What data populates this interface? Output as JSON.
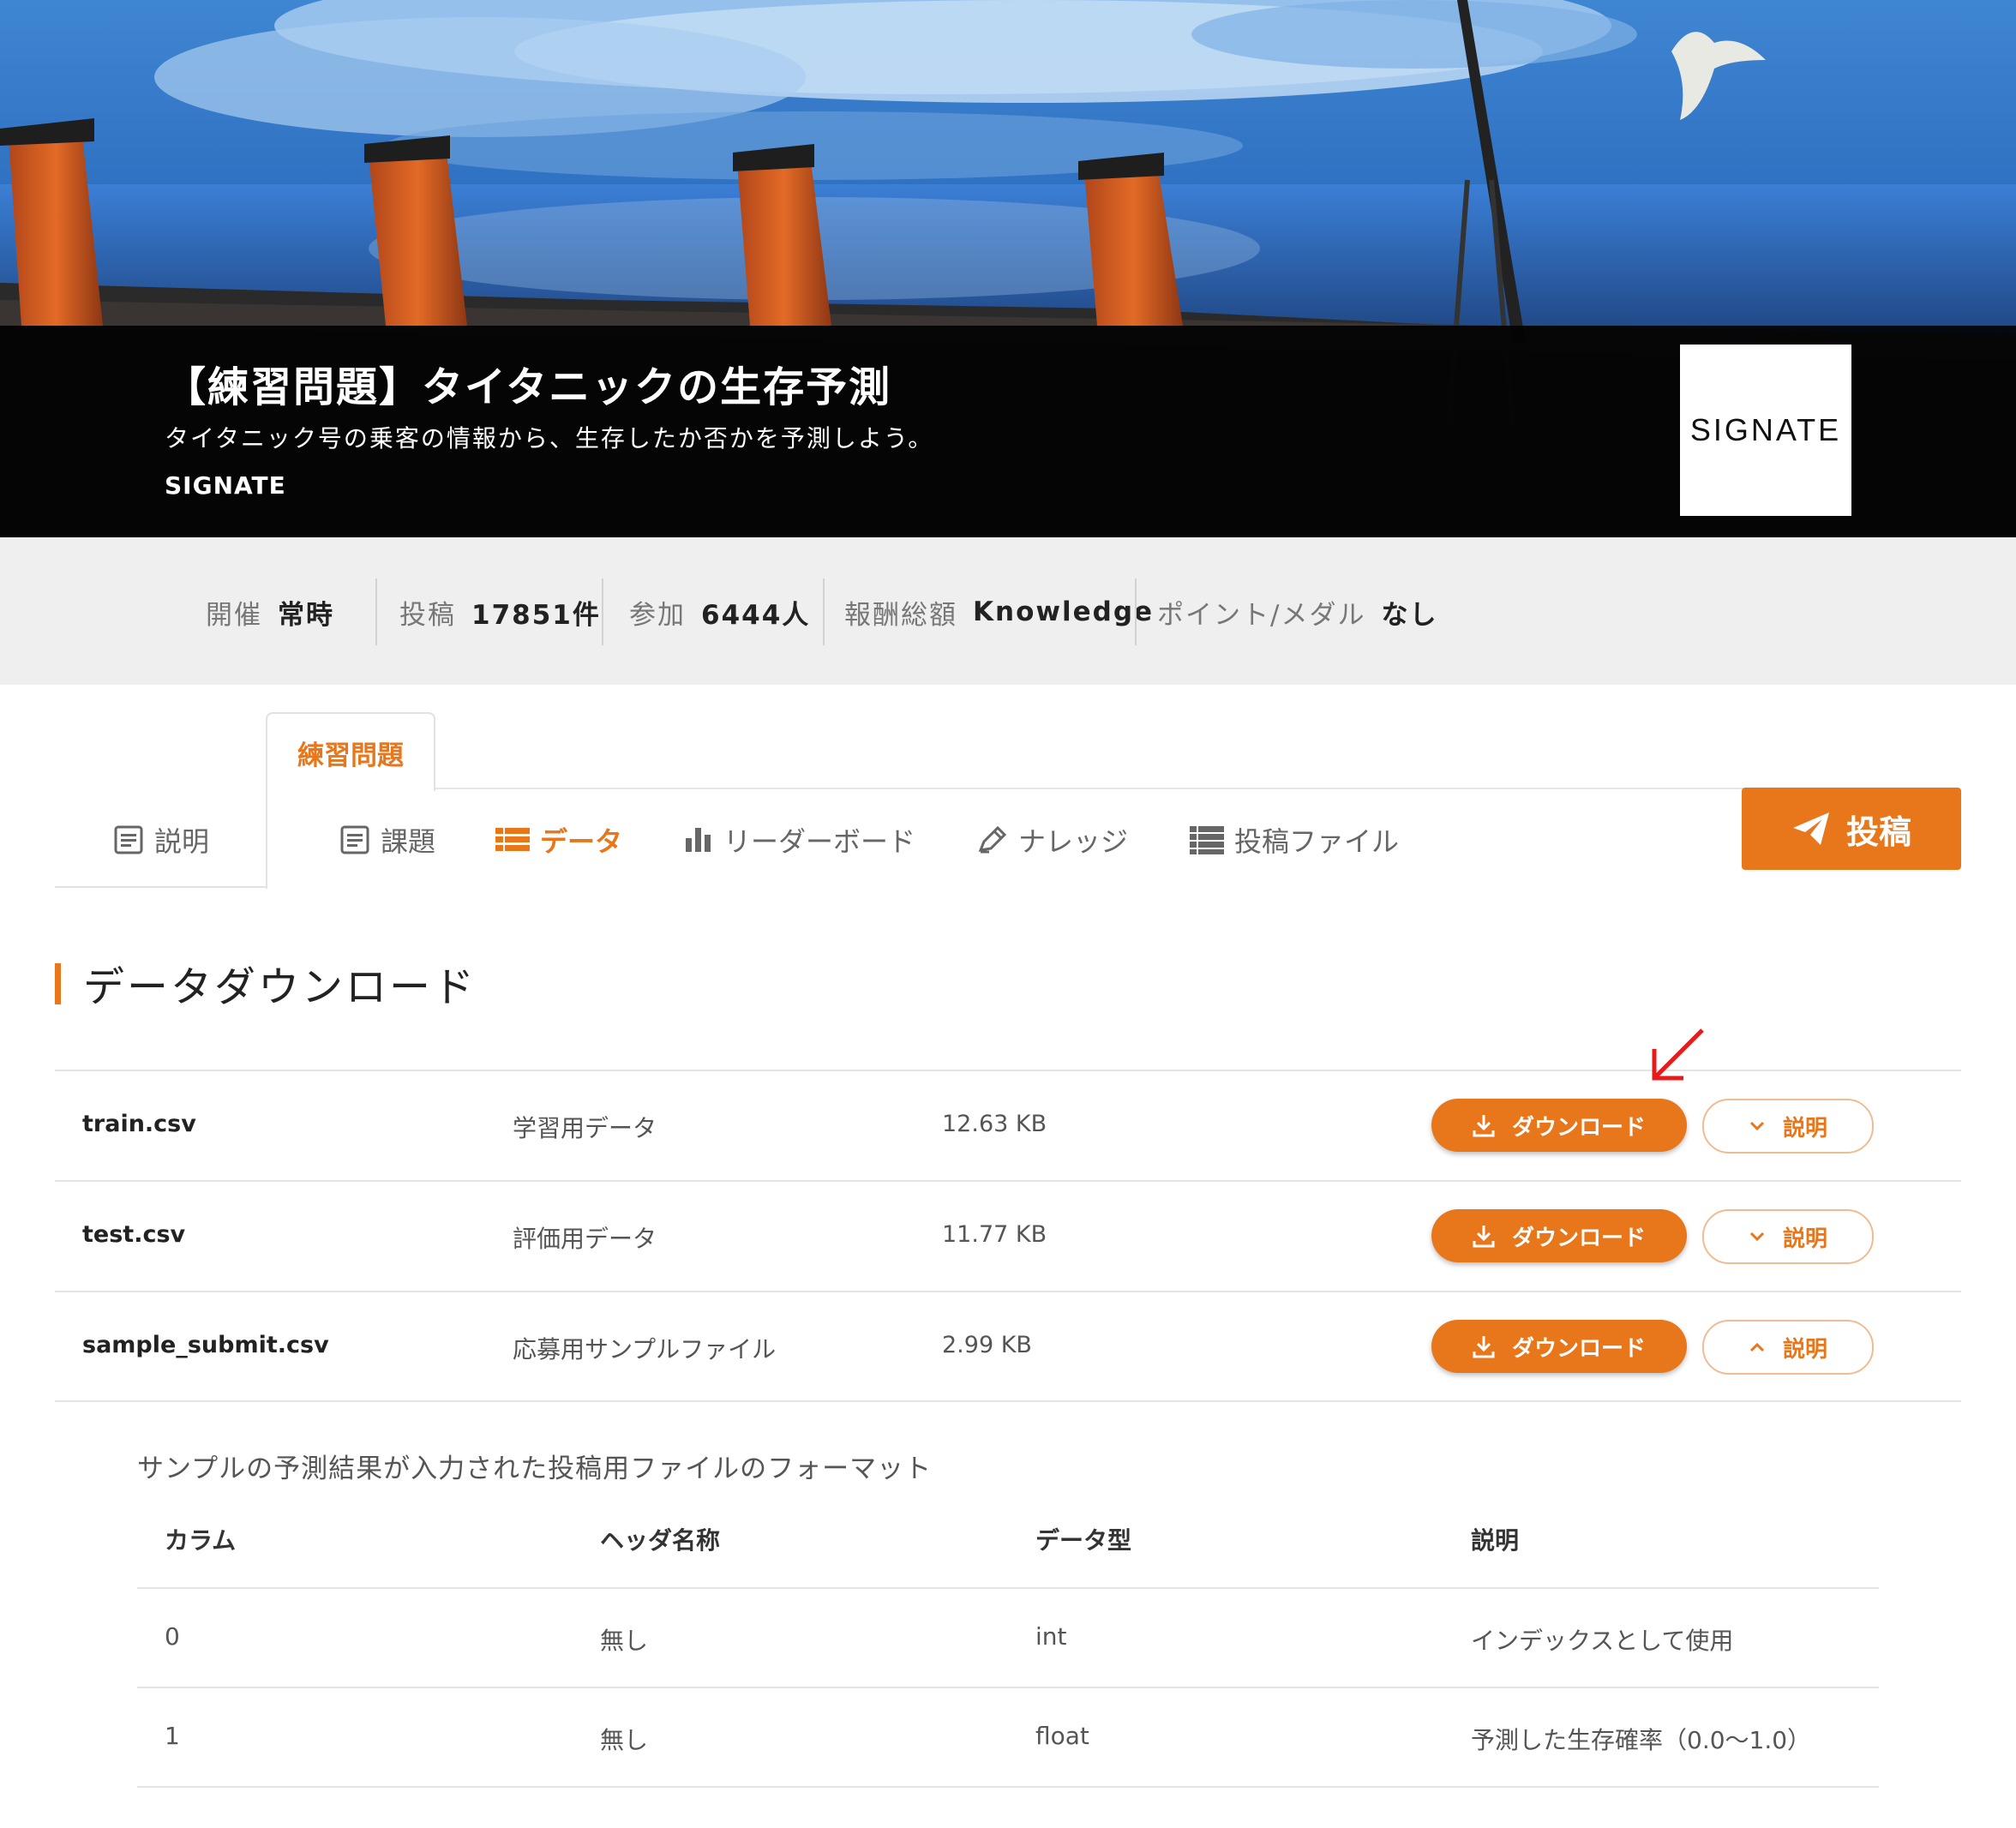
{
  "hero": {
    "title": "【練習問題】タイタニックの生存予測",
    "subtitle": "タイタニック号の乗客の情報から、生存したか否かを予測しよう。",
    "organizer": "SIGNATE",
    "logo_text": "SIGNATE"
  },
  "stats": [
    {
      "label": "開催",
      "value": "常時"
    },
    {
      "label": "投稿",
      "value": "17851件"
    },
    {
      "label": "参加",
      "value": "6444人"
    },
    {
      "label": "報酬総額",
      "value": "Knowledge"
    },
    {
      "label": "ポイント/メダル",
      "value": "なし"
    }
  ],
  "tabs": {
    "practice_label": "練習問題",
    "description_label": "説明",
    "items": [
      {
        "label": "課題",
        "icon": "document-icon"
      },
      {
        "label": "データ",
        "icon": "list-icon"
      },
      {
        "label": "リーダーボード",
        "icon": "bar-chart-icon"
      },
      {
        "label": "ナレッジ",
        "icon": "pencil-icon"
      },
      {
        "label": "投稿ファイル",
        "icon": "table-icon"
      }
    ],
    "active": "データ",
    "post_button": "投稿"
  },
  "section": {
    "title": "データダウンロード"
  },
  "files": [
    {
      "name": "train.csv",
      "description": "学習用データ",
      "size": "12.63 KB",
      "download_label": "ダウンロード",
      "explain_label": "説明",
      "expanded": false
    },
    {
      "name": "test.csv",
      "description": "評価用データ",
      "size": "11.77 KB",
      "download_label": "ダウンロード",
      "explain_label": "説明",
      "expanded": false
    },
    {
      "name": "sample_submit.csv",
      "description": "応募用サンプルファイル",
      "size": "2.99 KB",
      "download_label": "ダウンロード",
      "explain_label": "説明",
      "expanded": true
    }
  ],
  "format": {
    "caption": "サンプルの予測結果が入力された投稿用ファイルのフォーマット",
    "headers": [
      "カラム",
      "ヘッダ名称",
      "データ型",
      "説明"
    ],
    "rows": [
      [
        "0",
        "無し",
        "int",
        "インデックスとして使用"
      ],
      [
        "1",
        "無し",
        "float",
        "予測した生存確率（0.0〜1.0）"
      ]
    ]
  },
  "colors": {
    "accent": "#e8761a",
    "annotation_arrow": "#e81b1b"
  }
}
